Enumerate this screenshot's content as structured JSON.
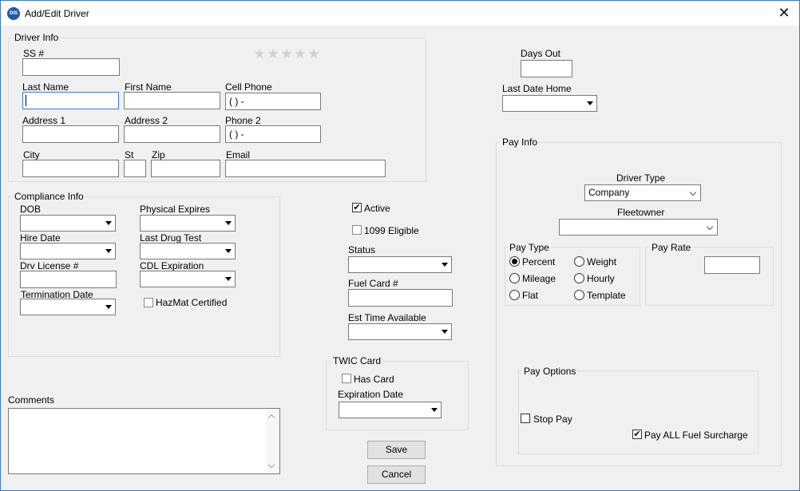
{
  "window": {
    "title": "Add/Edit Driver",
    "app_icon": "DIS"
  },
  "driver_info": {
    "title": "Driver Info",
    "ss_label": "SS #",
    "last_name_label": "Last Name",
    "first_name_label": "First Name",
    "cell_phone_label": "Cell Phone",
    "cell_phone_value": "(  )  -",
    "address1_label": "Address 1",
    "address2_label": "Address 2",
    "phone2_label": "Phone 2",
    "phone2_value": "(  )  -",
    "city_label": "City",
    "st_label": "St",
    "zip_label": "Zip",
    "email_label": "Email",
    "rating_stars": 0,
    "rating_max": 5
  },
  "compliance": {
    "title": "Compliance Info",
    "dob_label": "DOB",
    "physical_expires_label": "Physical Expires",
    "hire_date_label": "Hire Date",
    "last_drug_test_label": "Last Drug Test",
    "license_label": "Drv License #",
    "cdl_expiration_label": "CDL Expiration",
    "termination_label": "Termination Date",
    "hazmat_label": "HazMat Certified",
    "hazmat_checked": false
  },
  "status_section": {
    "active_label": "Active",
    "active_checked": true,
    "eligible_label": "1099 Eligible",
    "eligible_checked": false,
    "status_label": "Status",
    "fuel_card_label": "Fuel Card #",
    "est_time_label": "Est Time Available"
  },
  "twic": {
    "title": "TWIC Card",
    "has_card_label": "Has Card",
    "has_card_checked": false,
    "expiration_label": "Expiration Date"
  },
  "comments": {
    "label": "Comments"
  },
  "buttons": {
    "save": "Save",
    "cancel": "Cancel"
  },
  "days": {
    "days_out_label": "Days Out",
    "last_date_home_label": "Last Date Home"
  },
  "pay_info": {
    "title": "Pay Info",
    "driver_type_label": "Driver Type",
    "driver_type_value": "Company",
    "fleetowner_label": "Fleetowner",
    "pay_type_title": "Pay Type",
    "pay_types": [
      "Percent",
      "Weight",
      "Mileage",
      "Hourly",
      "Flat",
      "Template"
    ],
    "pay_type_selected": "Percent",
    "pay_rate_title": "Pay Rate",
    "pay_options_title": "Pay Options",
    "stop_pay_label": "Stop Pay",
    "stop_pay_checked": false,
    "fuel_surcharge_label": "Pay ALL Fuel Surcharge",
    "fuel_surcharge_checked": true
  },
  "icons": {
    "close": "close-icon",
    "star": "star-icon",
    "dropdown": "chevron-down-icon",
    "check": "check-icon"
  }
}
